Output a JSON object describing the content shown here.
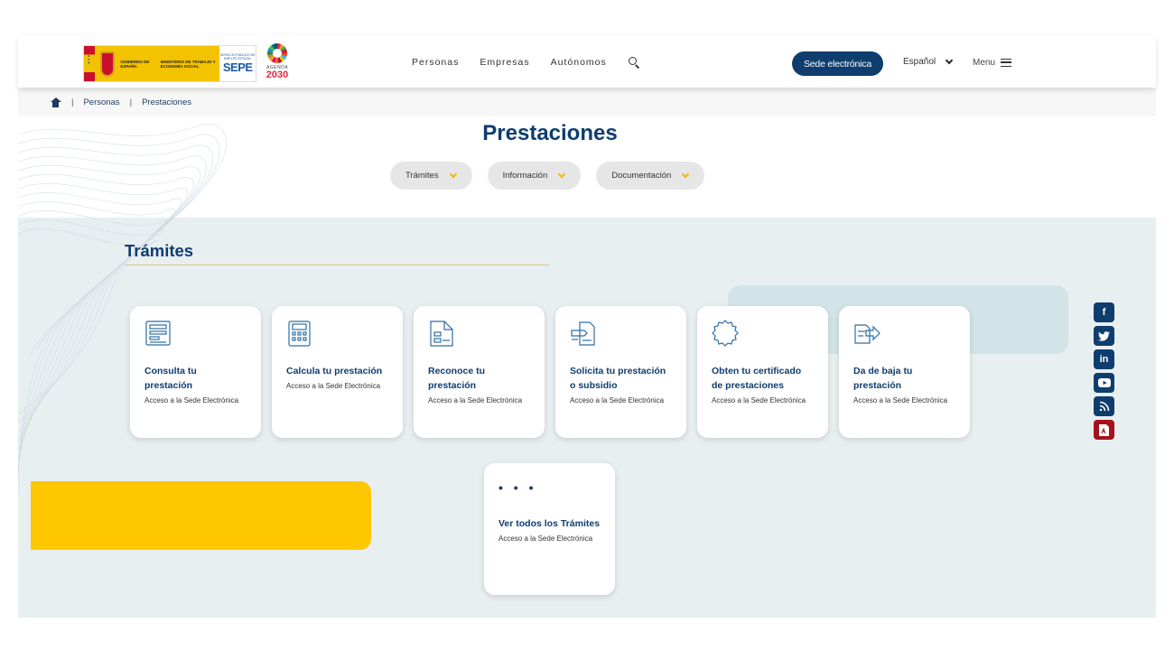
{
  "header": {
    "logo": {
      "gobierno": "GOBIERNO DE ESPAÑA",
      "ministerio": "MINISTERIO DE TRABAJO Y ECONOMÍA SOCIAL",
      "servicio": "SERVICIO PÚBLICO DE EMPLEO ESTATAL",
      "sepe": "SEPE",
      "agenda": "AGENDA",
      "agenda_year": "2030"
    },
    "nav": [
      "Personas",
      "Empresas",
      "Autónomos"
    ],
    "sede_button": "Sede electrónica",
    "language": "Español",
    "menu_label": "Menu"
  },
  "breadcrumb": [
    "Personas",
    "Prestaciones"
  ],
  "page_title": "Prestaciones",
  "filters": [
    "Trámites",
    "Información",
    "Documentación"
  ],
  "section_title": "Trámites",
  "cards": [
    {
      "title": "Consulta tu prestación",
      "subtitle": "Acceso a la Sede Electrónica",
      "icon": "form-icon"
    },
    {
      "title": "Calcula tu prestación",
      "subtitle": "Acceso a la Sede Electrónica",
      "icon": "calculator-icon"
    },
    {
      "title": "Reconoce tu prestación",
      "subtitle": "Acceso a la Sede Electrónica",
      "icon": "document-icon"
    },
    {
      "title": "Solicita tu prestación o subsidio",
      "subtitle": "Acceso a la Sede Electrónica",
      "icon": "request-icon"
    },
    {
      "title": "Obten tu certificado de prestaciones",
      "subtitle": "Acceso a la Sede Electrónica",
      "icon": "certificate-icon"
    },
    {
      "title": "Da de baja tu prestación",
      "subtitle": "Acceso a la Sede Electrónica",
      "icon": "cancel-icon"
    }
  ],
  "more_card": {
    "dots": "• • •",
    "title": "Ver todos los Trámites",
    "subtitle": "Acceso a la Sede Electrónica"
  },
  "social": [
    "facebook-icon",
    "twitter-icon",
    "linkedin-icon",
    "youtube-icon",
    "rss-icon",
    "pdf-icon"
  ],
  "colors": {
    "primary": "#0f3d6e",
    "accent": "#ffc700",
    "background": "#e8eff1",
    "pdf": "#a6121c"
  }
}
